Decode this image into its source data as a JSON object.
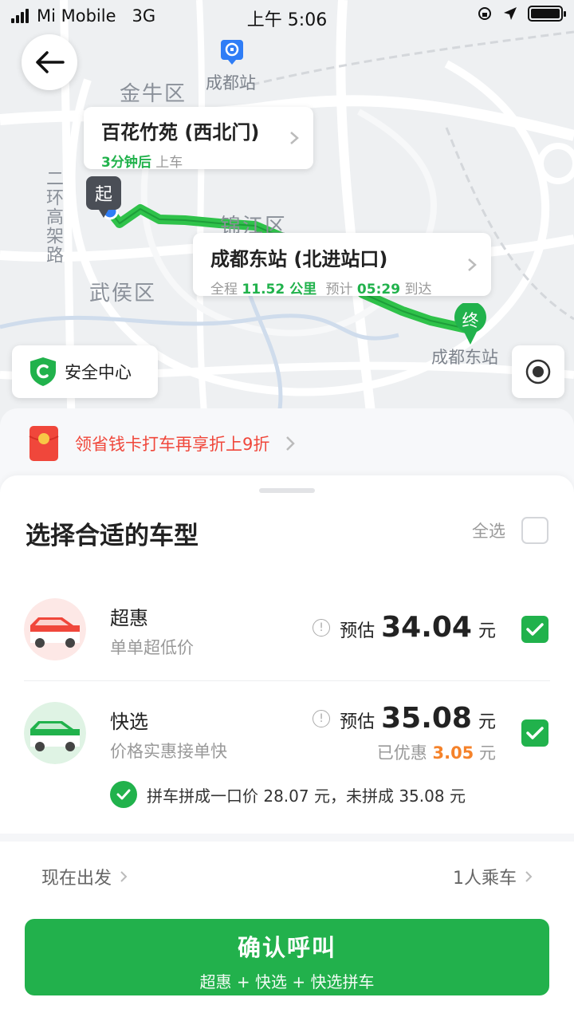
{
  "status_bar": {
    "carrier": "Mi Mobile",
    "network": "3G",
    "time": "上午 5:06"
  },
  "map": {
    "labels": {
      "jinniu": "金牛区",
      "jinjiang": "锦江区",
      "wuhou": "武侯区",
      "chengdu_station": "成都站",
      "chengdu_east": "成都东站",
      "ring_road": "二环高架路"
    },
    "start_pin": "起",
    "end_pin": "终"
  },
  "pickup": {
    "name": "百花竹苑 (西北门)",
    "eta": "3分钟后",
    "eta_suffix": "上车"
  },
  "destination": {
    "name": "成都东站 (北进站口)",
    "distance_label": "全程",
    "distance": "11.52 公里",
    "eta_label": "预计",
    "eta": "05:29",
    "eta_suffix": "到达"
  },
  "safety_center": "安全中心",
  "promo": {
    "text": "领省钱卡打车再享折上9折"
  },
  "sheet": {
    "title": "选择合适的车型",
    "select_all": "全选"
  },
  "cars": [
    {
      "name": "超惠",
      "desc": "单单超低价",
      "estimate_label": "预估",
      "price": "34.04",
      "unit": "元",
      "checked": true,
      "icon": "red-car-icon",
      "accent": "#f0473b"
    },
    {
      "name": "快选",
      "desc": "价格实惠接单快",
      "estimate_label": "预估",
      "price": "35.08",
      "unit": "元",
      "discount_label": "已优惠",
      "discount": "3.05",
      "discount_unit": "元",
      "checked": true,
      "icon": "green-car-icon",
      "accent": "#21b24c"
    }
  ],
  "carpool": {
    "text": "拼车拼成一口价 28.07 元，未拼成 35.08 元",
    "checked": true
  },
  "options": {
    "departure": "现在出发",
    "passengers": "1人乘车"
  },
  "confirm": {
    "label": "确认呼叫",
    "summary": "超惠 + 快选 + 快选拼车"
  },
  "colors": {
    "brand_green": "#21b24c",
    "promo_red": "#f0473b",
    "discount_orange": "#f5822a"
  }
}
